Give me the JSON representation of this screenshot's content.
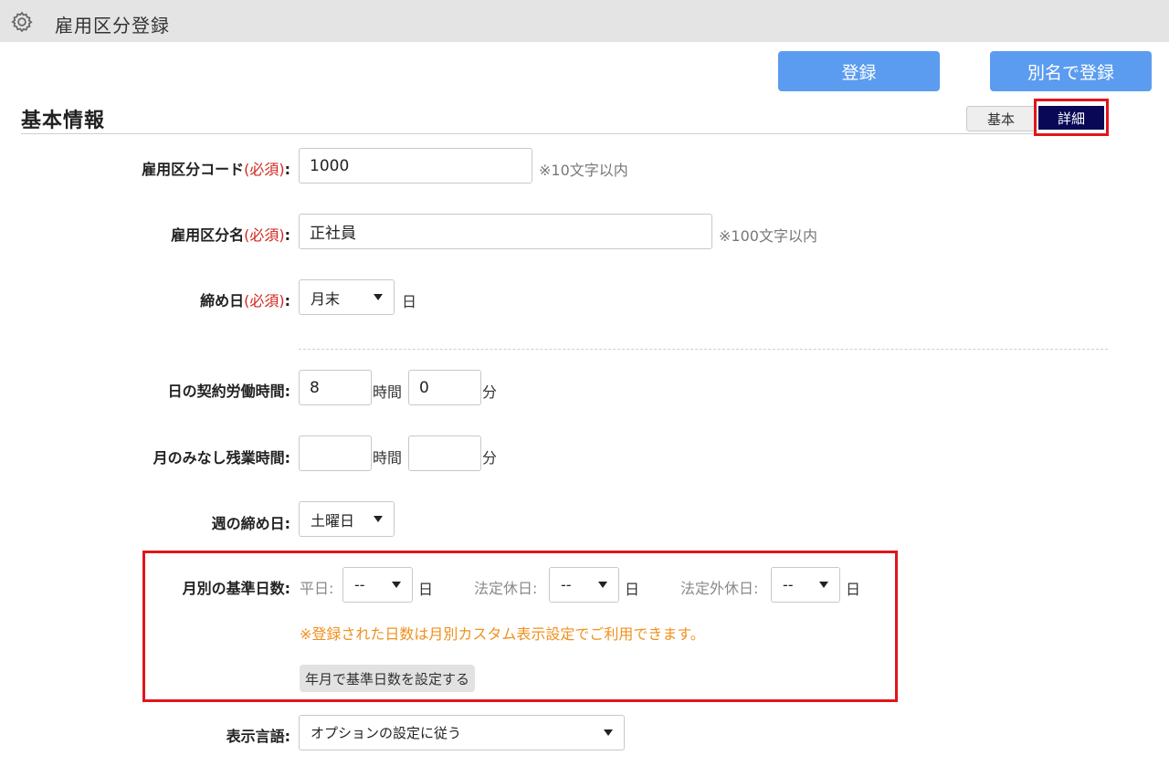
{
  "header": {
    "title": "雇用区分登録",
    "icon": "gear-icon"
  },
  "actions": {
    "register_label": "登録",
    "register_as_label": "別名で登録",
    "accent_color": "#5b9cf0"
  },
  "section": {
    "title": "基本情報",
    "toggle_basic": "基本",
    "toggle_detail": "詳細"
  },
  "fields": {
    "code": {
      "label": "雇用区分コード",
      "required": "(必須)",
      "colon": ":",
      "value": "1000",
      "hint": "※10文字以内"
    },
    "name": {
      "label": "雇用区分名",
      "required": "(必須)",
      "colon": ":",
      "value": "正社員",
      "hint": "※100文字以内"
    },
    "closing_day": {
      "label": "締め日",
      "required": "(必須)",
      "colon": ":",
      "value": "月末",
      "unit": "日"
    },
    "daily_hours": {
      "label": "日の契約労働時間:",
      "hours": "8",
      "hours_unit": "時間",
      "minutes": "0",
      "minutes_unit": "分"
    },
    "monthly_overtime": {
      "label": "月のみなし残業時間:",
      "hours": "",
      "hours_unit": "時間",
      "minutes": "",
      "minutes_unit": "分"
    },
    "week_closing": {
      "label": "週の締め日:",
      "value": "土曜日"
    },
    "monthly_base_days": {
      "label": "月別の基準日数:",
      "weekday_label": "平日:",
      "weekday_value": "--",
      "weekday_unit": "日",
      "legal_holiday_label": "法定休日:",
      "legal_holiday_value": "--",
      "legal_holiday_unit": "日",
      "non_legal_holiday_label": "法定外休日:",
      "non_legal_holiday_value": "--",
      "non_legal_holiday_unit": "日",
      "notice": "※登録された日数は月別カスタム表示設定でご利用できます。",
      "set_button": "年月で基準日数を設定する"
    },
    "display_language": {
      "label": "表示言語:",
      "value": "オプションの設定に従う"
    }
  }
}
